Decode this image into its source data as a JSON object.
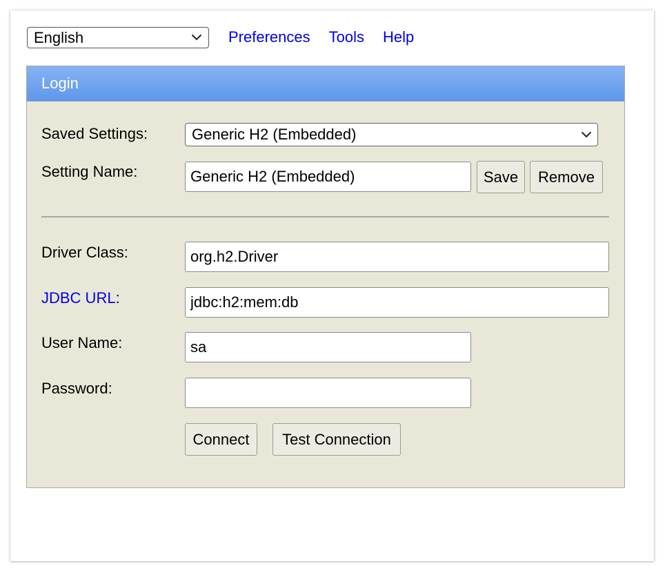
{
  "topbar": {
    "language": "English",
    "links": [
      "Preferences",
      "Tools",
      "Help"
    ]
  },
  "login": {
    "title": "Login",
    "saved_settings_label": "Saved Settings:",
    "saved_settings_value": "Generic H2 (Embedded)",
    "setting_name_label": "Setting Name:",
    "setting_name_value": "Generic H2 (Embedded)",
    "save_button": "Save",
    "remove_button": "Remove",
    "driver_class_label": "Driver Class:",
    "driver_class_value": "org.h2.Driver",
    "jdbc_url_link": "JDBC URL",
    "jdbc_url_suffix": ":",
    "jdbc_url_value": "jdbc:h2:mem:db",
    "user_name_label": "User Name:",
    "user_name_value": "sa",
    "password_label": "Password:",
    "password_value": "",
    "connect_button": "Connect",
    "test_connection_button": "Test Connection"
  },
  "colors": {
    "panel_background": "#e9e8d8",
    "header_gradient_top": "#86b3f2",
    "header_gradient_bottom": "#5e97ec",
    "link": "#0000ee"
  },
  "icons": {
    "dropdown": "chevron-down-icon"
  }
}
